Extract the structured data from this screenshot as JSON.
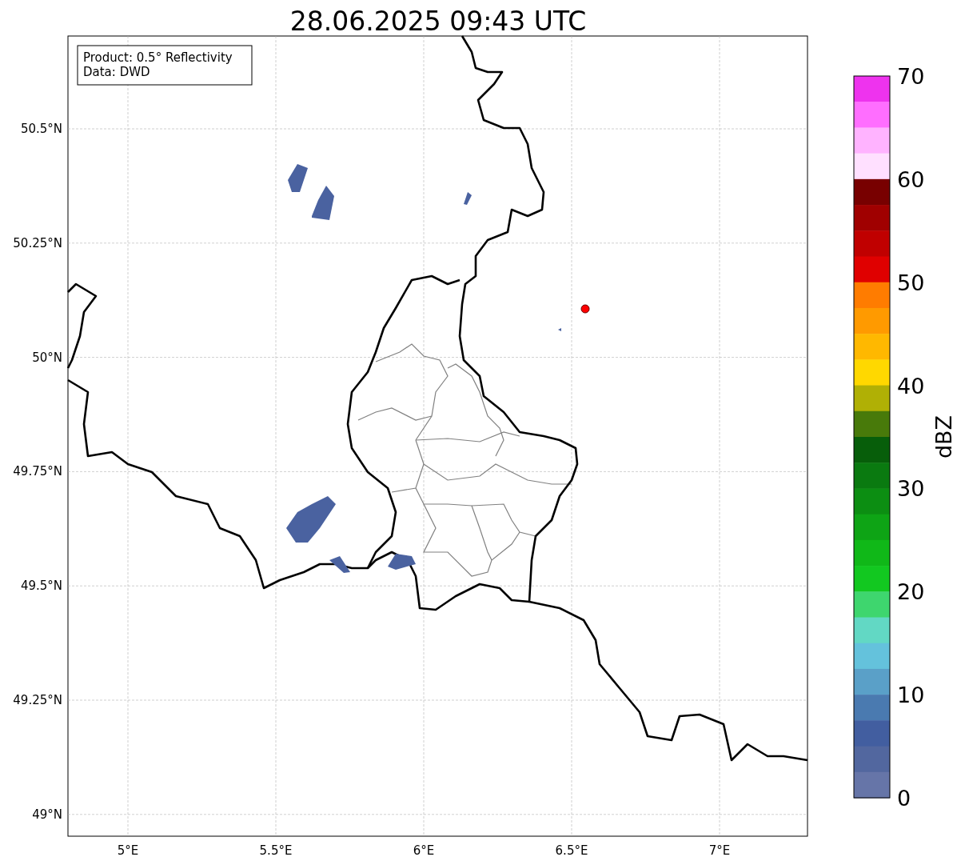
{
  "title": "28.06.2025 09:43 UTC",
  "legend": [
    "Product: 0.5° Reflectivity",
    "Data: DWD"
  ],
  "map": {
    "lat_ticks": [
      "50.5°N",
      "50.25°N",
      "50°N",
      "49.75°N",
      "49.5°N",
      "49.25°N",
      "49°N"
    ],
    "lon_ticks": [
      "5°E",
      "5.5°E",
      "6°E",
      "6.5°E",
      "7°E"
    ]
  },
  "colorbar": {
    "label": "dBZ",
    "ticks": [
      "70",
      "60",
      "50",
      "40",
      "30",
      "20",
      "10",
      "0"
    ],
    "bins": [
      {
        "color": "#ee33ee"
      },
      {
        "color": "#ff6eff"
      },
      {
        "color": "#ffb3ff"
      },
      {
        "color": "#ffe0ff"
      },
      {
        "color": "#780000"
      },
      {
        "color": "#a00000"
      },
      {
        "color": "#c00000"
      },
      {
        "color": "#e00000"
      },
      {
        "color": "#ff7c00"
      },
      {
        "color": "#ff9a00"
      },
      {
        "color": "#ffb800"
      },
      {
        "color": "#ffd800"
      },
      {
        "color": "#b0b005"
      },
      {
        "color": "#487a0a"
      },
      {
        "color": "#075e0a"
      },
      {
        "color": "#0a7a10"
      },
      {
        "color": "#0c8e12"
      },
      {
        "color": "#0ea415"
      },
      {
        "color": "#10b818"
      },
      {
        "color": "#12c820"
      },
      {
        "color": "#3ed66e"
      },
      {
        "color": "#62d8c4"
      },
      {
        "color": "#64c2dc"
      },
      {
        "color": "#5aa0c8"
      },
      {
        "color": "#4a7ab0"
      },
      {
        "color": "#425ea0"
      },
      {
        "color": "#52679f"
      },
      {
        "color": "#6675a8"
      }
    ]
  }
}
